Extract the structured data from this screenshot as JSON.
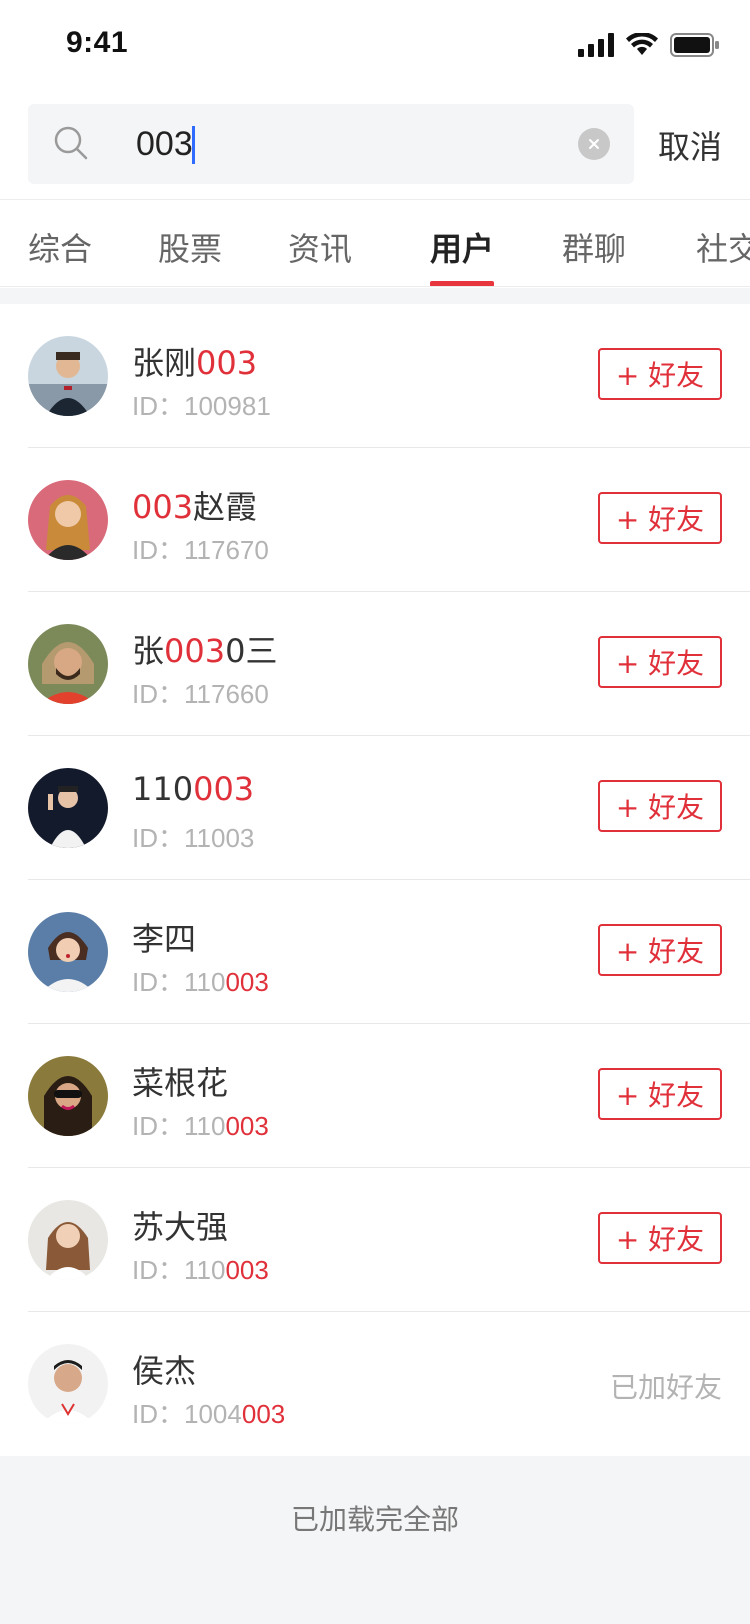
{
  "status_bar": {
    "time": "9:41"
  },
  "search": {
    "value": "003",
    "cancel_label": "取消"
  },
  "tabs": [
    {
      "label": "综合"
    },
    {
      "label": "股票"
    },
    {
      "label": "资讯"
    },
    {
      "label": "用户",
      "active": true
    },
    {
      "label": "群聊"
    },
    {
      "label": "社交"
    }
  ],
  "users": [
    {
      "name_pre": "张刚",
      "name_hl": "003",
      "name_post": "",
      "id_label": "ID：",
      "id_plain": "100981",
      "id_hl": "",
      "action": "+ 好友"
    },
    {
      "name_pre": "",
      "name_hl": "003",
      "name_post": "赵霞",
      "id_label": "ID：",
      "id_plain": "117670",
      "id_hl": "",
      "action": "+ 好友"
    },
    {
      "name_pre": "张",
      "name_hl": "003",
      "name_post": "0三",
      "id_label": "ID：",
      "id_plain": "117660",
      "id_hl": "",
      "action": "+ 好友"
    },
    {
      "name_pre": "110",
      "name_hl": "003",
      "name_post": "",
      "id_label": "ID：",
      "id_plain": "11003",
      "id_hl": "",
      "action": "+ 好友"
    },
    {
      "name_pre": "李四",
      "name_hl": "",
      "name_post": "",
      "id_label": "ID：",
      "id_plain": "110",
      "id_hl": "003",
      "action": "+ 好友"
    },
    {
      "name_pre": "菜根花",
      "name_hl": "",
      "name_post": "",
      "id_label": "ID：",
      "id_plain": "110",
      "id_hl": "003",
      "action": "+ 好友"
    },
    {
      "name_pre": "苏大强",
      "name_hl": "",
      "name_post": "",
      "id_label": "ID：",
      "id_plain": "110",
      "id_hl": "003",
      "action": "+ 好友"
    },
    {
      "name_pre": "侯杰",
      "name_hl": "",
      "name_post": "",
      "id_label": "ID：",
      "id_plain": "1004",
      "id_hl": "003",
      "action": "已加好友"
    }
  ],
  "footer": {
    "text": "已加载完全部"
  },
  "colors": {
    "accent": "#e0313b",
    "muted": "#b3b3b3",
    "bg": "#f4f5f7"
  }
}
